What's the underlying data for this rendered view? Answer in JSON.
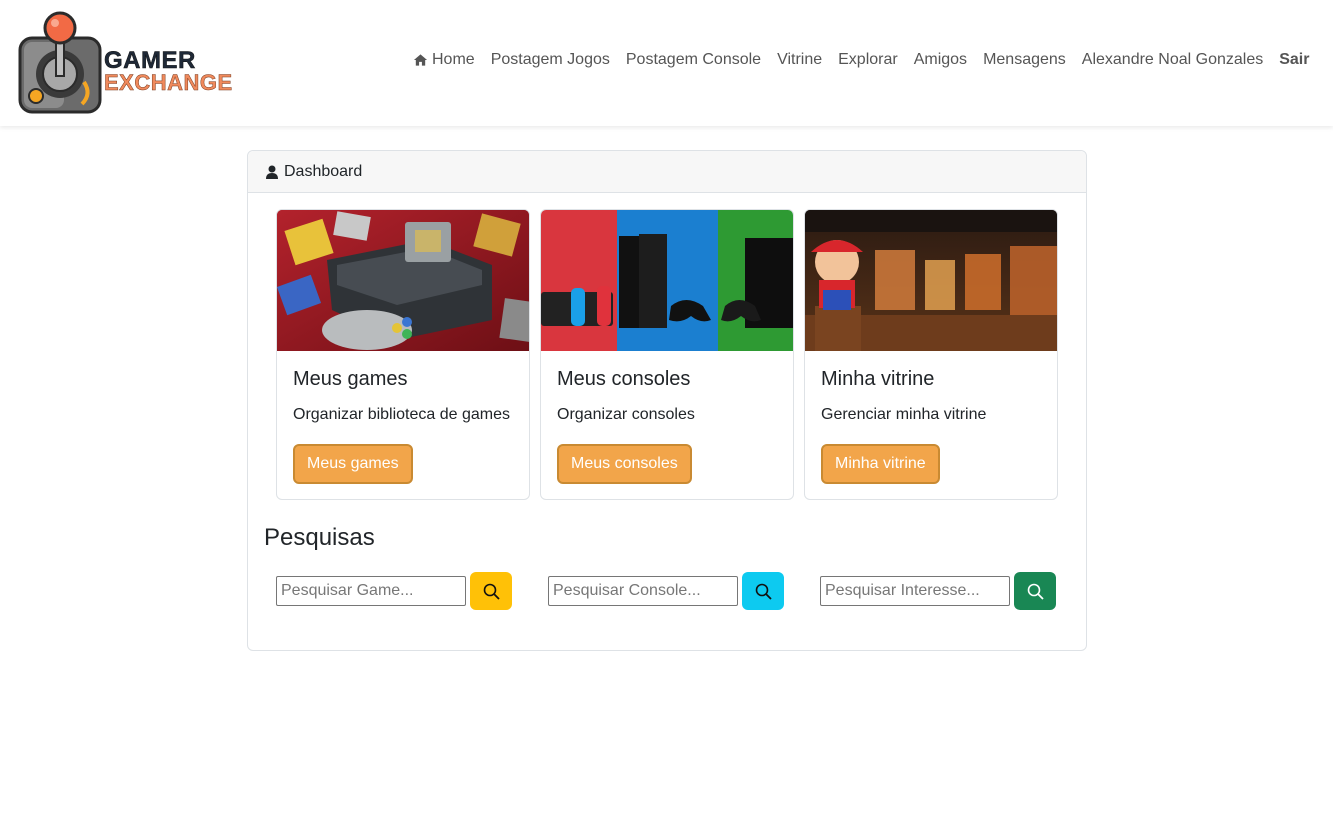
{
  "brand": {
    "line1": "GAMER",
    "line2": "EXCHANGE",
    "logo_icon": "joystick-logo-icon"
  },
  "nav": {
    "home": "Home",
    "postagem_jogos": "Postagem Jogos",
    "postagem_console": "Postagem Console",
    "vitrine": "Vitrine",
    "explorar": "Explorar",
    "amigos": "Amigos",
    "mensagens": "Mensagens",
    "user": "Alexandre Noal Gonzales",
    "sair": "Sair"
  },
  "dashboard": {
    "header": "Dashboard",
    "tiles": [
      {
        "title": "Meus games",
        "desc": "Organizar biblioteca de games",
        "button": "Meus games"
      },
      {
        "title": "Meus consoles",
        "desc": "Organizar consoles",
        "button": "Meus consoles"
      },
      {
        "title": "Minha vitrine",
        "desc": "Gerenciar minha vitrine",
        "button": "Minha vitrine"
      }
    ]
  },
  "searches": {
    "title": "Pesquisas",
    "items": [
      {
        "placeholder": "Pesquisar Game...",
        "color": "#ffc107"
      },
      {
        "placeholder": "Pesquisar Console...",
        "color": "#0dcaf0"
      },
      {
        "placeholder": "Pesquisar Interesse...",
        "color": "#198754"
      }
    ]
  },
  "colors": {
    "accent_button": "#f2a54a",
    "logo_orange": "#f08a5d"
  }
}
